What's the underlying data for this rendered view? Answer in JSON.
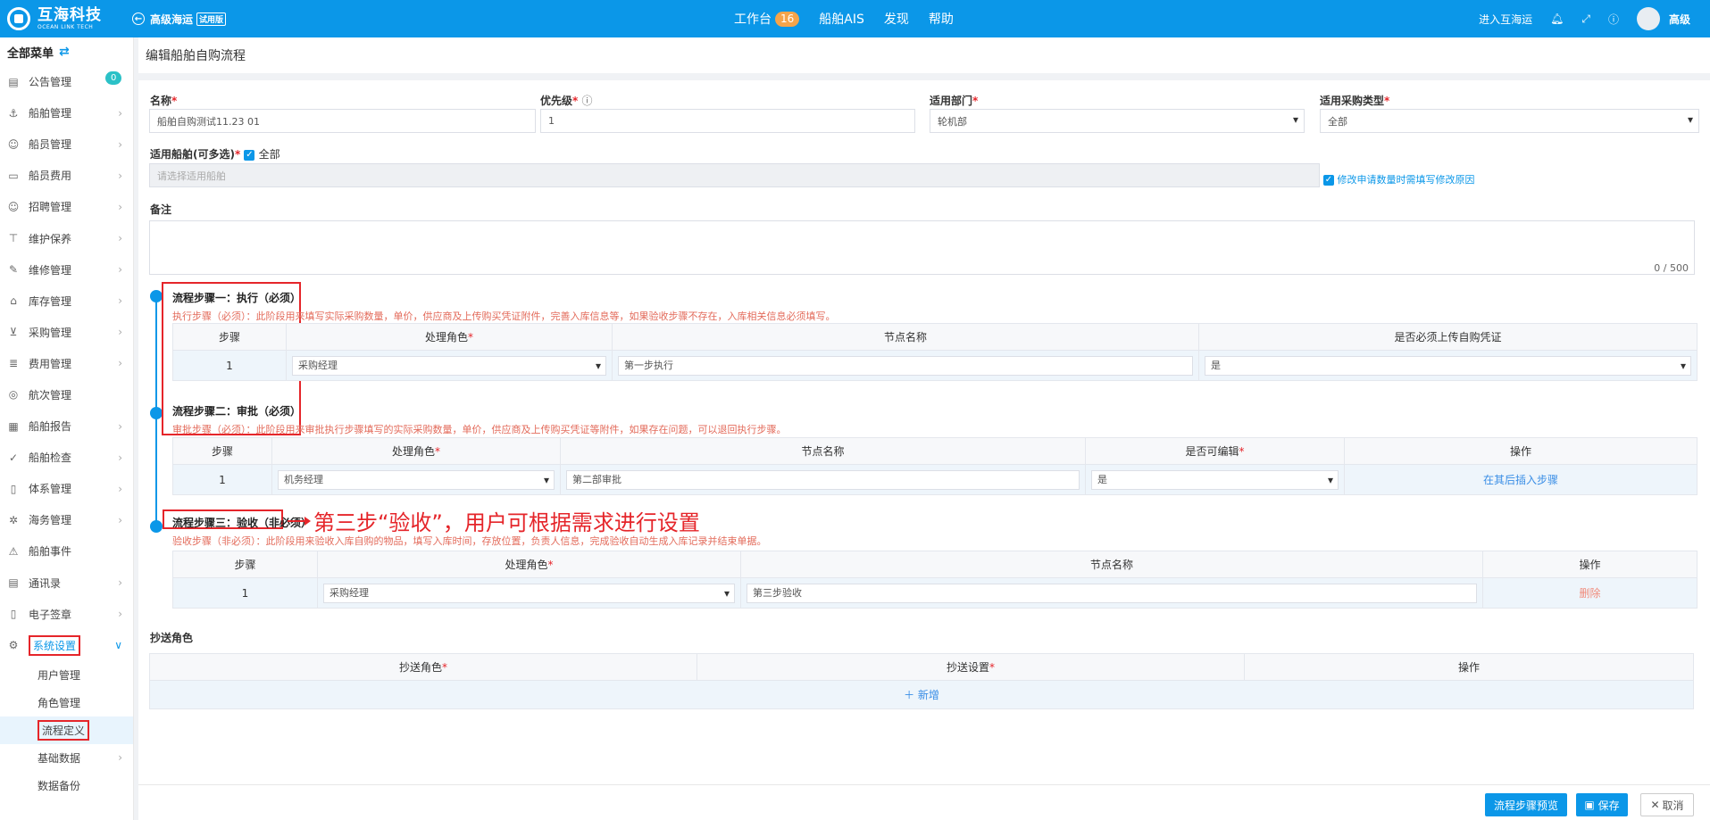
{
  "topbar": {
    "logo_cn": "互海科技",
    "logo_en": "OCEAN LINK TECH",
    "back_label": "高级海运",
    "trial_tag": "试用版",
    "nav": [
      {
        "label": "工作台",
        "badge": "16"
      },
      {
        "label": "船舶AIS"
      },
      {
        "label": "发现"
      },
      {
        "label": "帮助"
      }
    ],
    "enter_label": "进入互海运",
    "user_name": "高级"
  },
  "sidebar": {
    "title": "全部菜单",
    "notice_badge": "0",
    "items": [
      {
        "label": "公告管理",
        "icon": "notice-icon"
      },
      {
        "label": "船舶管理",
        "icon": "anchor-icon"
      },
      {
        "label": "船员管理",
        "icon": "person-icon"
      },
      {
        "label": "船员费用",
        "icon": "wallet-icon"
      },
      {
        "label": "招聘管理",
        "icon": "recruit-icon"
      },
      {
        "label": "维护保养",
        "icon": "hammer-icon"
      },
      {
        "label": "维修管理",
        "icon": "wrench-icon"
      },
      {
        "label": "库存管理",
        "icon": "warehouse-icon"
      },
      {
        "label": "采购管理",
        "icon": "cart-icon"
      },
      {
        "label": "费用管理",
        "icon": "coins-icon"
      },
      {
        "label": "航次管理",
        "icon": "globe-icon"
      },
      {
        "label": "船舶报告",
        "icon": "report-icon"
      },
      {
        "label": "船舶检查",
        "icon": "check-icon"
      },
      {
        "label": "体系管理",
        "icon": "doc-icon"
      },
      {
        "label": "海务管理",
        "icon": "helm-icon"
      },
      {
        "label": "船舶事件",
        "icon": "warning-icon"
      },
      {
        "label": "通讯录",
        "icon": "contacts-icon"
      },
      {
        "label": "电子签章",
        "icon": "stamp-icon"
      },
      {
        "label": "系统设置",
        "icon": "gear-icon"
      }
    ],
    "sub_items": [
      "用户管理",
      "角色管理",
      "流程定义",
      "基础数据",
      "数据备份"
    ]
  },
  "page": {
    "title": "编辑船舶自购流程"
  },
  "form": {
    "name_label": "名称",
    "name_value": "船舶自购测试11.23 01",
    "priority_label": "优先级",
    "priority_value": "1",
    "dept_label": "适用部门",
    "dept_value": "轮机部",
    "purchase_type_label": "适用采购类型",
    "purchase_type_value": "全部",
    "ships_label": "适用船舶(可多选)",
    "ships_all_label": "全部",
    "ships_placeholder": "请选择适用船舶",
    "modify_reason_label": "修改申请数量时需填写修改原因",
    "remark_label": "备注",
    "remark_counter": "0 / 500"
  },
  "steps": [
    {
      "title": "流程步骤一：执行（必须）",
      "desc": "执行步骤（必须）：此阶段用来填写实际采购数量，单价，供应商及上传购买凭证附件，完善入库信息等，如果验收步骤不存在，入库相关信息必须填写。",
      "headers": [
        "步骤",
        "处理角色",
        "节点名称",
        "是否必须上传自购凭证"
      ],
      "row": {
        "step": "1",
        "role": "采购经理",
        "node": "第一步执行",
        "extra": "是"
      }
    },
    {
      "title": "流程步骤二：审批（必须）",
      "desc": "审批步骤（必须）：此阶段用来审批执行步骤填写的实际采购数量，单价，供应商及上传购买凭证等附件，如果存在问题，可以退回执行步骤。",
      "headers": [
        "步骤",
        "处理角色",
        "节点名称",
        "是否可编辑",
        "操作"
      ],
      "row": {
        "step": "1",
        "role": "机务经理",
        "node": "第二部审批",
        "extra": "是",
        "action": "在其后插入步骤"
      }
    },
    {
      "title": "流程步骤三：验收（非必须）",
      "desc": "验收步骤（非必须）：此阶段用来验收入库自购的物品，填写入库时间，存放位置，负责人信息，完成验收自动生成入库记录并结束单据。",
      "headers": [
        "步骤",
        "处理角色",
        "节点名称",
        "操作"
      ],
      "row": {
        "step": "1",
        "role": "采购经理",
        "node": "第三步验收",
        "action": "删除"
      }
    }
  ],
  "annotation": "第三步“验收”，用户可根据需求进行设置",
  "cc": {
    "label": "抄送角色",
    "headers": [
      "抄送角色",
      "抄送设置",
      "操作"
    ],
    "add_label": "新增"
  },
  "footer": {
    "preview_label": "流程步骤预览",
    "save_label": "保存",
    "cancel_label": "取消"
  },
  "colors": {
    "primary": "#0b97e8",
    "annotation_red": "#e5252a",
    "hint": "#e36b5b"
  }
}
